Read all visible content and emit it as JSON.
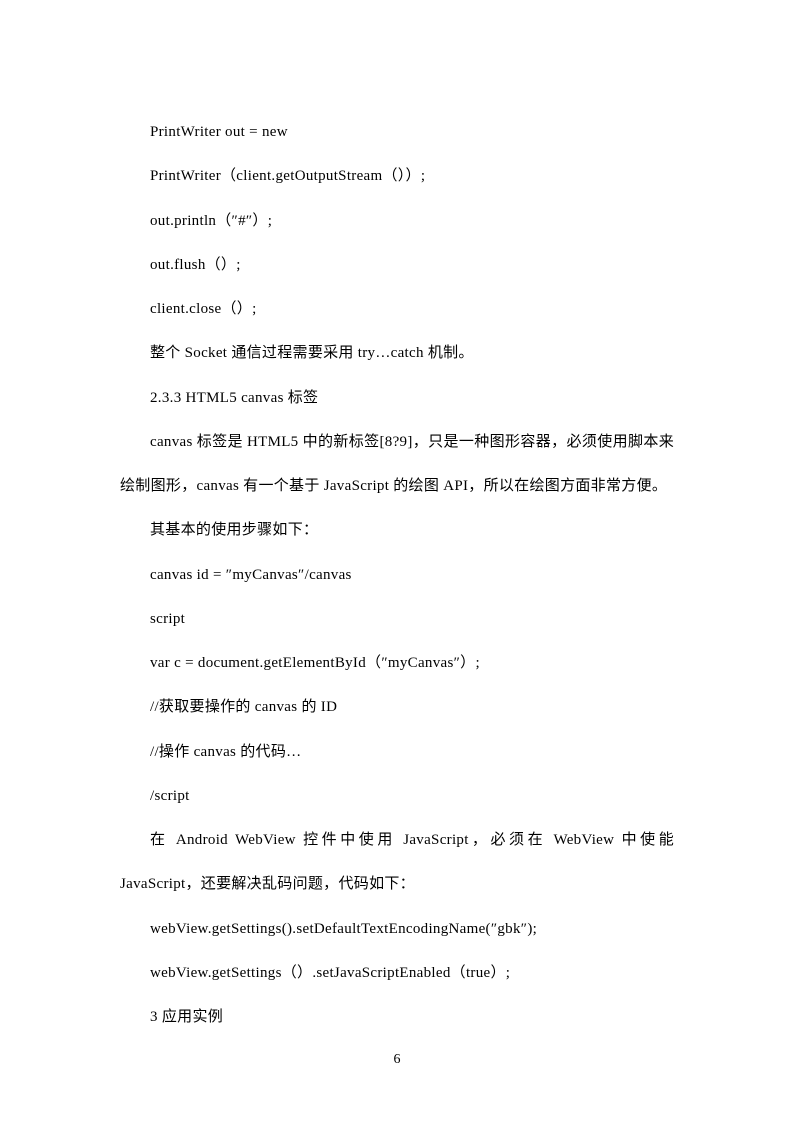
{
  "lines": [
    {
      "text": "PrintWriter out = new",
      "indent": true
    },
    {
      "text": "PrintWriter（client.getOutputStream（））;",
      "indent": true
    },
    {
      "text": "out.println（″#″）;",
      "indent": true
    },
    {
      "text": "out.flush（）;",
      "indent": true
    },
    {
      "text": "client.close（）;",
      "indent": true
    },
    {
      "text": "整个 Socket 通信过程需要采用 try…catch 机制。",
      "indent": true
    },
    {
      "text": "2.3.3 HTML5 canvas 标签",
      "indent": true
    },
    {
      "text": "canvas 标签是 HTML5 中的新标签[8?9]，只是一种图形容器，必须使用脚本来绘制图形，canvas 有一个基于 JavaScript 的绘图 API，所以在绘图方面非常方便。",
      "indent": true
    },
    {
      "text": "其基本的使用步骤如下：",
      "indent": true
    },
    {
      "text": "canvas id = ″myCanvas″/canvas",
      "indent": true
    },
    {
      "text": "script",
      "indent": true
    },
    {
      "text": "var c = document.getElementById（″myCanvas″）;",
      "indent": true
    },
    {
      "text": "//获取要操作的 canvas 的 ID",
      "indent": true
    },
    {
      "text": "//操作 canvas 的代码…",
      "indent": true
    },
    {
      "text": "/script",
      "indent": true
    },
    {
      "text": "在 Android WebView 控件中使用 JavaScript，必须在 WebView 中使能 JavaScript，还要解决乱码问题，代码如下：",
      "indent": true
    },
    {
      "text": "webView.getSettings().setDefaultTextEncodingName(″gbk″);",
      "indent": true
    },
    {
      "text": "webView.getSettings（）.setJavaScriptEnabled（true）;",
      "indent": true
    },
    {
      "text": "3 应用实例",
      "indent": true
    }
  ],
  "page_number": "6"
}
